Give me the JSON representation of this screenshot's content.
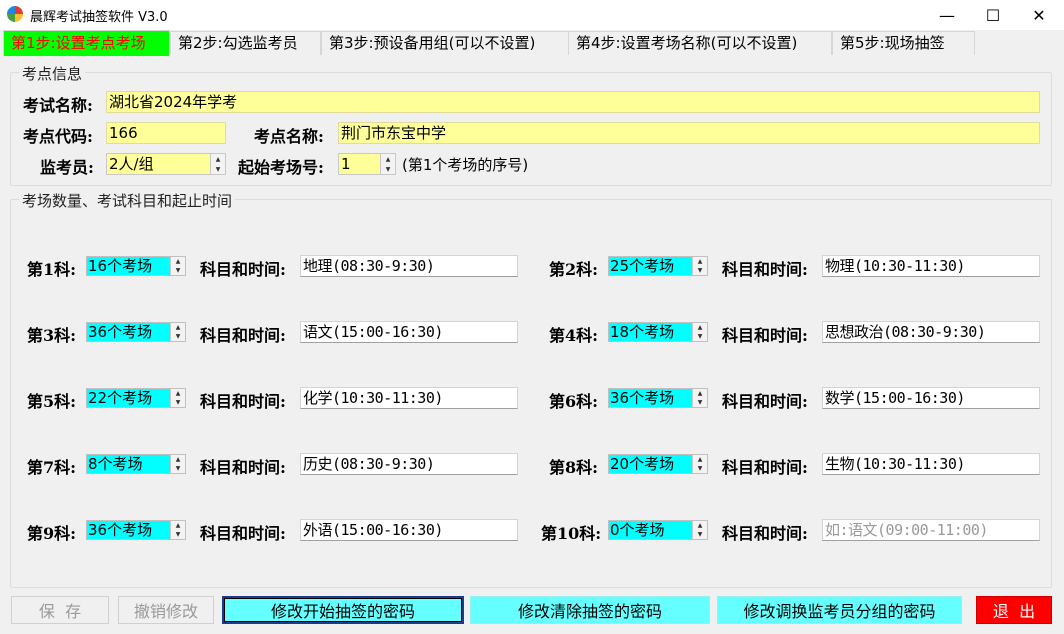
{
  "window": {
    "title": "晨辉考试抽签软件 V3.0",
    "min_glyph": "—",
    "max_glyph": "☐",
    "close_glyph": "✕"
  },
  "tabs": [
    {
      "label": "第1步:设置考点考场",
      "active": true
    },
    {
      "label": "第2步:勾选监考员",
      "active": false
    },
    {
      "label": "第3步:预设备用组(可以不设置)",
      "active": false
    },
    {
      "label": "第4步:设置考场名称(可以不设置)",
      "active": false
    },
    {
      "label": "第5步:现场抽签",
      "active": false
    }
  ],
  "site": {
    "group_title": "考点信息",
    "exam_name_label": "考试名称:",
    "exam_name": "湖北省2024年学考",
    "site_code_label": "考点代码:",
    "site_code": "166",
    "site_name_label": "考点名称:",
    "site_name": "荆门市东宝中学",
    "invigilators_label": "监考员:",
    "invigilators": "2人/组",
    "start_room_label": "起始考场号:",
    "start_room": "1",
    "start_room_hint": "(第1个考场的序号)"
  },
  "subjects_group_title": "考场数量、考试科目和起止时间",
  "time_label": "科目和时间:",
  "subjects": [
    {
      "label": "第1科:",
      "rooms": "16个考场",
      "time": "地理(08:30-9:30)",
      "placeholder": false
    },
    {
      "label": "第2科:",
      "rooms": "25个考场",
      "time": "物理(10:30-11:30)",
      "placeholder": false
    },
    {
      "label": "第3科:",
      "rooms": "36个考场",
      "time": "语文(15:00-16:30)",
      "placeholder": false
    },
    {
      "label": "第4科:",
      "rooms": "18个考场",
      "time": "思想政治(08:30-9:30)",
      "placeholder": false
    },
    {
      "label": "第5科:",
      "rooms": "22个考场",
      "time": "化学(10:30-11:30)",
      "placeholder": false
    },
    {
      "label": "第6科:",
      "rooms": "36个考场",
      "time": "数学(15:00-16:30)",
      "placeholder": false
    },
    {
      "label": "第7科:",
      "rooms": "8个考场",
      "time": "历史(08:30-9:30)",
      "placeholder": false
    },
    {
      "label": "第8科:",
      "rooms": "20个考场",
      "time": "生物(10:30-11:30)",
      "placeholder": false
    },
    {
      "label": "第9科:",
      "rooms": "36个考场",
      "time": "外语(15:00-16:30)",
      "placeholder": false
    },
    {
      "label": "第10科:",
      "rooms": "0个考场",
      "time": "如:语文(09:00-11:00)",
      "placeholder": true
    }
  ],
  "buttons": {
    "save": "保  存",
    "undo": "撤销修改",
    "change_start_pwd": "修改开始抽签的密码",
    "change_clear_pwd": "修改清除抽签的密码",
    "change_swap_pwd": "修改调换监考员分组的密码",
    "exit": "退  出"
  },
  "colors": {
    "active_tab_bg": "#00ff00",
    "active_tab_text": "#ff0000",
    "field_yellow": "#ffff99",
    "room_cyan": "#00ffff",
    "button_cyan": "#66ffff",
    "exit_red": "#ff0000"
  }
}
